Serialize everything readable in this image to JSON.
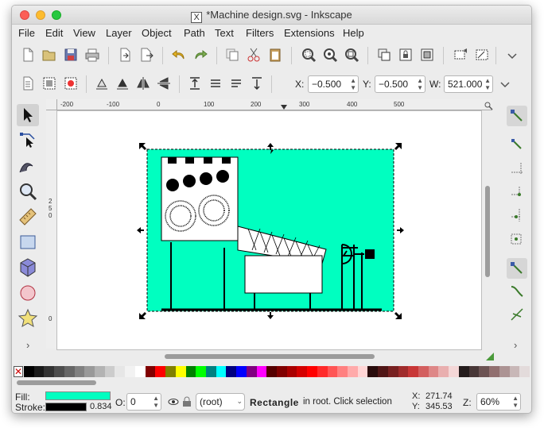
{
  "window": {
    "title": "*Machine design.svg - Inkscape",
    "app_icon": "x11-icon"
  },
  "menu": [
    "File",
    "Edit",
    "View",
    "Layer",
    "Object",
    "Path",
    "Text",
    "Filters",
    "Extensions",
    "Help"
  ],
  "toolbar_main": {
    "icons": [
      "new-document-icon",
      "open-icon",
      "save-icon",
      "print-icon",
      "import-icon",
      "export-icon",
      "undo-icon",
      "redo-icon",
      "duplicate-icon",
      "cut-icon",
      "paste-icon",
      "zoom-selection-icon",
      "zoom-drawing-icon",
      "zoom-page-icon",
      "clone-icon",
      "lock-icon",
      "group-icon",
      "align-icon",
      "edit-node-icon"
    ],
    "more": "chevron-down-icon"
  },
  "toolbar_select": {
    "x_label": "X:",
    "x_value": "−0.500",
    "y_label": "Y:",
    "y_value": "−0.500",
    "w_label": "W:",
    "w_value": "521.000",
    "more": "chevron-down-icon"
  },
  "rulers": {
    "h_ticks": [
      "-200",
      "-100",
      "0",
      "100",
      "200",
      "300",
      "400",
      "500"
    ],
    "v_ticks": [
      "2",
      "5",
      "0",
      "0"
    ]
  },
  "tools": [
    "selector-arrow-icon",
    "node-edit-icon",
    "tweak-icon",
    "zoom-icon",
    "measure-icon",
    "rectangle-icon",
    "3d-box-icon",
    "ellipse-icon",
    "star-icon"
  ],
  "tools_more": "›",
  "snap_more": "›",
  "canvas": {
    "page_fill": "#00ffc0",
    "drawing": "machine-diagram"
  },
  "palette": [
    "#000000",
    "#1a1a1a",
    "#333333",
    "#4d4d4d",
    "#666666",
    "#808080",
    "#999999",
    "#b3b3b3",
    "#cccccc",
    "#e6e6e6",
    "#f2f2f2",
    "#ffffff",
    "#800000",
    "#ff0000",
    "#808000",
    "#ffff00",
    "#008000",
    "#00ff00",
    "#008080",
    "#00ffff",
    "#000080",
    "#0000ff",
    "#800080",
    "#ff00ff",
    "#550000",
    "#800000",
    "#aa0000",
    "#d40000",
    "#ff0000",
    "#ff2a2a",
    "#ff5555",
    "#ff8080",
    "#ffaaaa",
    "#ffd5d5",
    "#280b0b",
    "#501616",
    "#782121",
    "#a02c2c",
    "#c83737",
    "#d35f5f",
    "#de8787",
    "#e9afaf",
    "#f4d7d7",
    "#241c1c",
    "#483737",
    "#6c5353",
    "#916f6f",
    "#ac9393",
    "#c8b7b7",
    "#e3dbdb"
  ],
  "status": {
    "fill_label": "Fill:",
    "fill_color": "#00ffc0",
    "stroke_label": "Stroke:",
    "stroke_color": "#000000",
    "stroke_width": "0.834",
    "opacity_label": "O:",
    "opacity_value": "0",
    "layer": "(root)",
    "message_bold": "Rectangle",
    "message": " in root. Click selection",
    "x_label": "X:",
    "x_value": "271.74",
    "y_label": "Y:",
    "y_value": "345.53",
    "z_label": "Z:",
    "zoom_value": "60%"
  }
}
